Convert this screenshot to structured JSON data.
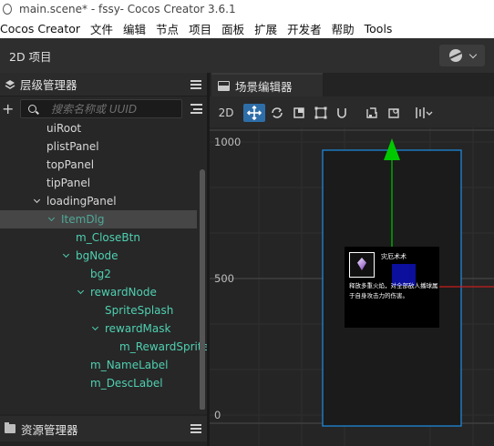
{
  "window": {
    "title": "main.scene* - fssy- Cocos Creator 3.6.1"
  },
  "menubar": {
    "items": [
      "Cocos Creator",
      "文件",
      "编辑",
      "节点",
      "项目",
      "面板",
      "扩展",
      "开发者",
      "帮助",
      "Tools"
    ]
  },
  "toolbar": {
    "mode_label": "2D 项目"
  },
  "hierarchy": {
    "title": "层级管理器",
    "search_placeholder": "搜索名称或 UUID",
    "nodes": [
      {
        "label": "uiRoot"
      },
      {
        "label": "plistPanel"
      },
      {
        "label": "topPanel"
      },
      {
        "label": "tipPanel"
      },
      {
        "label": "loadingPanel"
      },
      {
        "label": "ItemDlg"
      },
      {
        "label": "m_CloseBtn"
      },
      {
        "label": "bgNode"
      },
      {
        "label": "bg2"
      },
      {
        "label": "rewardNode"
      },
      {
        "label": "SpriteSplash"
      },
      {
        "label": "rewardMask"
      },
      {
        "label": "m_RewardSprite"
      },
      {
        "label": "m_NameLabel"
      },
      {
        "label": "m_DescLabel"
      }
    ]
  },
  "assets": {
    "title": "资源管理器"
  },
  "scene": {
    "tab_title": "场景编辑器",
    "tools": {
      "mode_2d": "2D"
    },
    "axis_labels": {
      "y_1000": "1000",
      "y_500": "500",
      "y_0": "0"
    },
    "popup": {
      "title": "灾厄术术",
      "description": "释放多重火焰，对全部敌人播球属于自身攻击力的伤害。"
    }
  },
  "colors": {
    "accent_blue": "#2e6ea8",
    "prefab_text": "#4fd0b1",
    "gizmo_green": "#00c800",
    "gizmo_red": "#c81e1e",
    "canvas_border": "#1e88d8"
  }
}
